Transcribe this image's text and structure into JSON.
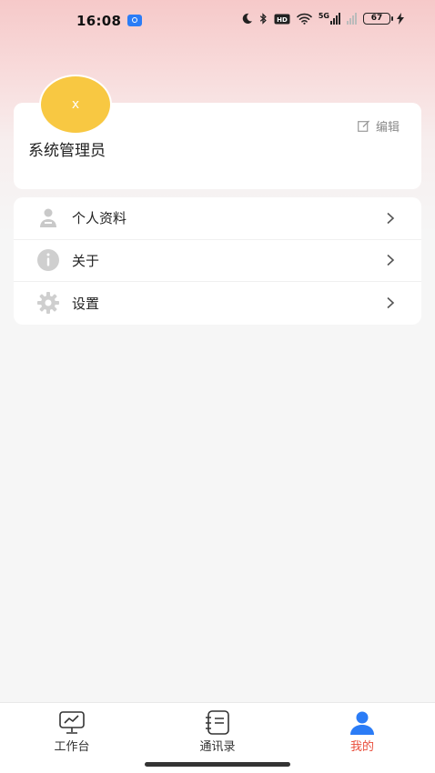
{
  "status_bar": {
    "time": "16:08",
    "battery": "67",
    "signal_text": "5G"
  },
  "profile": {
    "avatar_text": "x",
    "name": "系统管理员",
    "edit_label": "编辑"
  },
  "menu": {
    "items": [
      {
        "label": "个人资料",
        "icon": "person-icon"
      },
      {
        "label": "关于",
        "icon": "info-icon"
      },
      {
        "label": "设置",
        "icon": "gear-icon"
      }
    ]
  },
  "bottom_nav": {
    "items": [
      {
        "label": "工作台",
        "icon": "workbench-icon",
        "active": false
      },
      {
        "label": "通讯录",
        "icon": "contacts-icon",
        "active": false
      },
      {
        "label": "我的",
        "icon": "profile-icon",
        "active": true
      }
    ]
  },
  "colors": {
    "accent_active": "#e94e3c",
    "avatar_bg": "#f8c842",
    "active_icon": "#2b7cf6"
  }
}
